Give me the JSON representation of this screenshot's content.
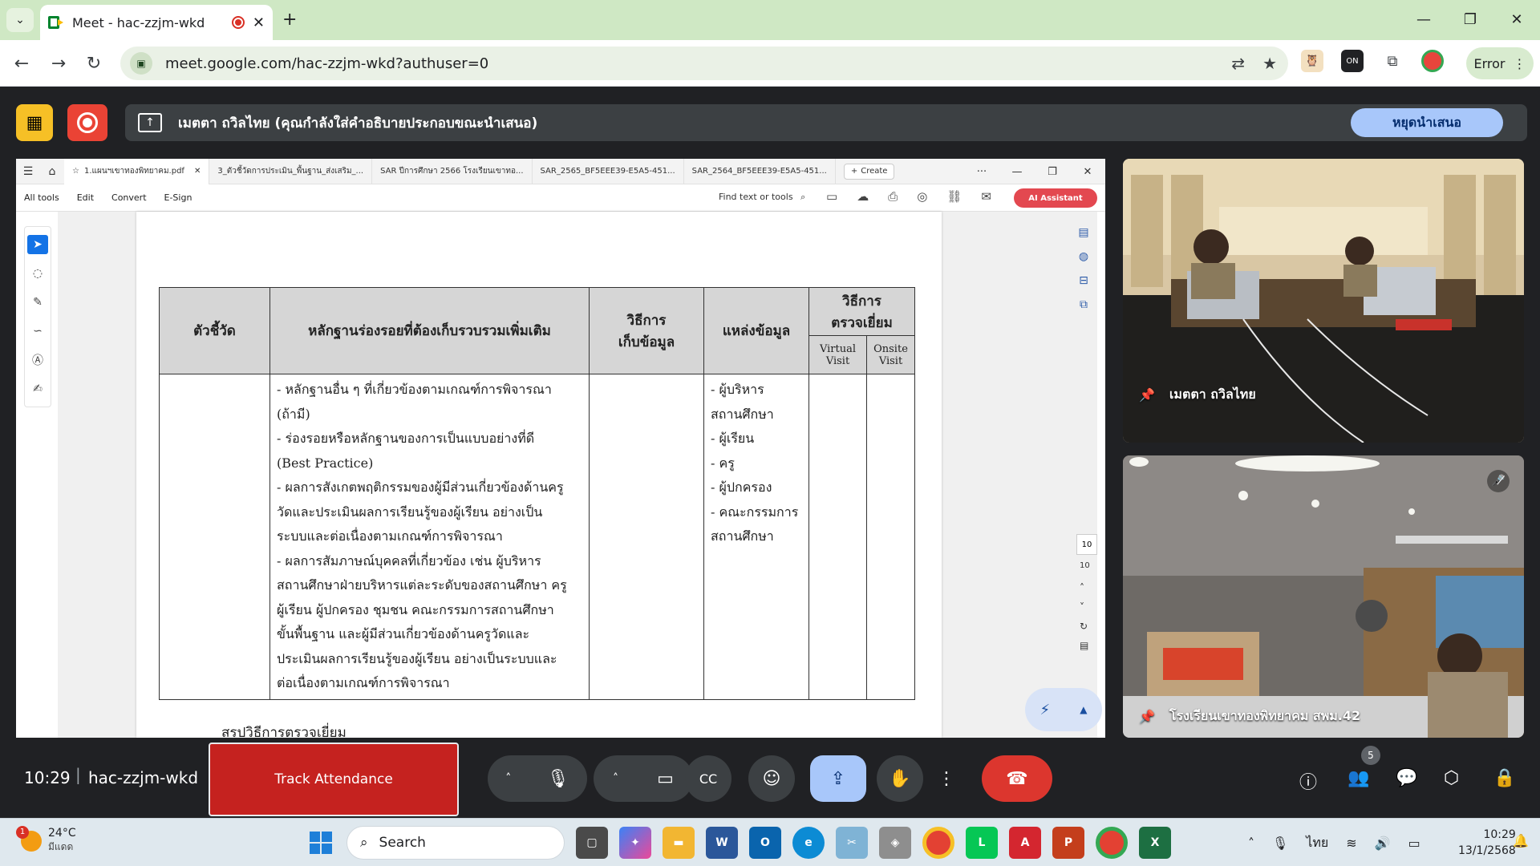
{
  "browser": {
    "tab_title": "Meet - hac-zzjm-wkd",
    "url": "meet.google.com/hac-zzjm-wkd?authuser=0",
    "profile_label": "Error"
  },
  "presentation": {
    "banner_text": "เมตตา ถวิลไทย (คุณกำลังใส่คำอธิบายประกอบขณะนำเสนอ)",
    "stop_label": "หยุดนำเสนอ"
  },
  "acrobat": {
    "tabs": [
      "1.แผนฯเขาทองพิทยาคม.pdf",
      "3_ตัวชี้วัดการประเมิน_พื้นฐาน_ส่งเสริม_...",
      "SAR ปีการศึกษา 2566 โรงเรียนเขาทอ...",
      "SAR_2565_BF5EEE39-E5A5-451...",
      "SAR_2564_BF5EEE39-E5A5-451..."
    ],
    "create_label": "Create",
    "menu": [
      "All tools",
      "Edit",
      "Convert",
      "E-Sign"
    ],
    "find_label": "Find text or tools",
    "ai_label": "AI Assistant",
    "page_current": "10",
    "page_total": "10"
  },
  "doc": {
    "headers": {
      "indicator": "ตัวชี้วัด",
      "evidence": "หลักฐานร่องรอยที่ต้องเก็บรวบรวมเพิ่มเติม",
      "method": "วิธีการ\nเก็บข้อมูล",
      "source": "แหล่งข้อมูล",
      "visit": "วิธีการ\nตรวจเยี่ยม",
      "virtual": "Virtual\nVisit",
      "onsite": "Onsite\nVisit"
    },
    "evidence_lines": [
      "- หลักฐานอื่น ๆ ที่เกี่ยวข้องตามเกณฑ์การพิจารณา",
      "(ถ้ามี)",
      "- ร่องรอยหรือหลักฐานของการเป็นแบบอย่างที่ดี",
      "(Best Practice)",
      "- ผลการสังเกตพฤติกรรมของผู้มีส่วนเกี่ยวข้องด้านครู",
      "วัดและประเมินผลการเรียนรู้ของผู้เรียน อย่างเป็น",
      "ระบบและต่อเนื่องตามเกณฑ์การพิจารณา",
      "- ผลการสัมภาษณ์บุคคลที่เกี่ยวข้อง เช่น ผู้บริหาร",
      "สถานศึกษาฝ่ายบริหารแต่ละระดับของสถานศึกษา ครู",
      "ผู้เรียน ผู้ปกครอง ชุมชน คณะกรรมการสถานศึกษา",
      "ขั้นพื้นฐาน และผู้มีส่วนเกี่ยวข้องด้านครูวัดและ",
      "ประเมินผลการเรียนรู้ของผู้เรียน อย่างเป็นระบบและ",
      "ต่อเนื่องตามเกณฑ์การพิจารณา"
    ],
    "source_lines": [
      "- ผู้บริหาร",
      "สถานศึกษา",
      "- ผู้เรียน",
      "- ครู",
      "- ผู้ปกครอง",
      "- คณะกรรมการ",
      "สถานศึกษา"
    ],
    "summary_heading": "สรุปวิธีการตรวจเยี่ยม"
  },
  "participants": [
    {
      "name": "เมตตา ถวิลไทย"
    },
    {
      "name": "โรงเรียนเขาทองพิทยาคม สพม.42"
    }
  ],
  "meet": {
    "time": "10:29",
    "code": "hac-zzjm-wkd",
    "track_label": "Track Attendance",
    "people_count": "5"
  },
  "taskbar": {
    "temp": "24°C",
    "weather": "มีแดด",
    "weather_badge": "1",
    "search_label": "Search",
    "lang": "ไทย",
    "time": "10:29",
    "date": "13/1/2568"
  },
  "colors": {
    "chrome_tabstrip": "#cfe8c4",
    "meet_bg": "#202124",
    "hangup": "#dc362e",
    "track_attendance": "#c5221f",
    "stop_present": "#a8c7fa",
    "acrobat_ai": "#e34850"
  }
}
